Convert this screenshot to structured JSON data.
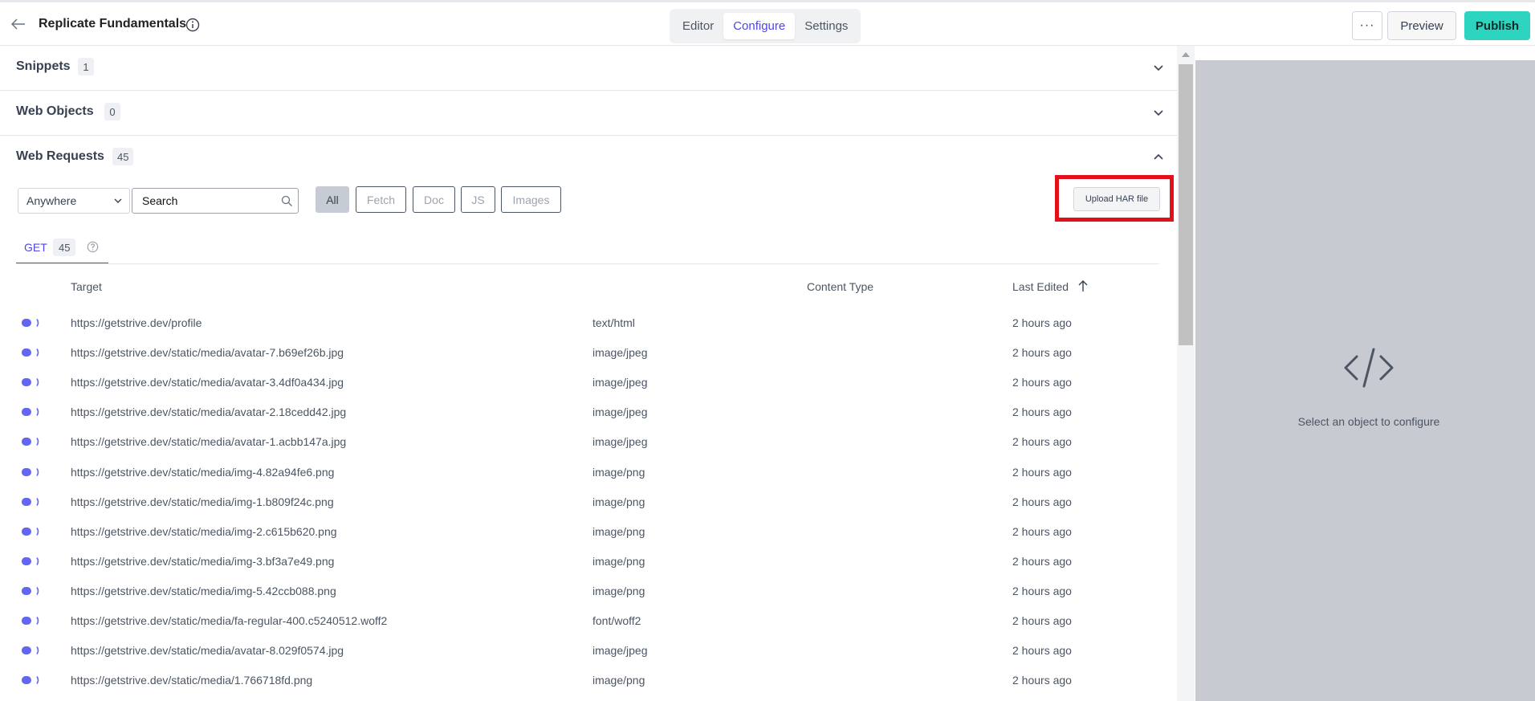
{
  "header": {
    "title": "Replicate Fundamentals",
    "tabs": [
      {
        "label": "Editor",
        "active": false
      },
      {
        "label": "Configure",
        "active": true
      },
      {
        "label": "Settings",
        "active": false
      }
    ],
    "more_label": "···",
    "preview_label": "Preview",
    "publish_label": "Publish"
  },
  "sections": {
    "snippets": {
      "title": "Snippets",
      "count": "1"
    },
    "web_objects": {
      "title": "Web Objects",
      "count": "0"
    },
    "web_requests": {
      "title": "Web Requests",
      "count": "45"
    }
  },
  "filters": {
    "location_select": "Anywhere",
    "search_placeholder": "Search",
    "chips": [
      "All",
      "Fetch",
      "Doc",
      "JS",
      "Images"
    ],
    "upload_label": "Upload HAR file"
  },
  "method_tab": {
    "label": "GET",
    "count": "45"
  },
  "columns": {
    "target": "Target",
    "content_type": "Content Type",
    "last_edited": "Last Edited"
  },
  "requests": [
    {
      "target": "https://getstrive.dev/profile",
      "type": "text/html",
      "edited": "2 hours ago"
    },
    {
      "target": "https://getstrive.dev/static/media/avatar-7.b69ef26b.jpg",
      "type": "image/jpeg",
      "edited": "2 hours ago"
    },
    {
      "target": "https://getstrive.dev/static/media/avatar-3.4df0a434.jpg",
      "type": "image/jpeg",
      "edited": "2 hours ago"
    },
    {
      "target": "https://getstrive.dev/static/media/avatar-2.18cedd42.jpg",
      "type": "image/jpeg",
      "edited": "2 hours ago"
    },
    {
      "target": "https://getstrive.dev/static/media/avatar-1.acbb147a.jpg",
      "type": "image/jpeg",
      "edited": "2 hours ago"
    },
    {
      "target": "https://getstrive.dev/static/media/img-4.82a94fe6.png",
      "type": "image/png",
      "edited": "2 hours ago"
    },
    {
      "target": "https://getstrive.dev/static/media/img-1.b809f24c.png",
      "type": "image/png",
      "edited": "2 hours ago"
    },
    {
      "target": "https://getstrive.dev/static/media/img-2.c615b620.png",
      "type": "image/png",
      "edited": "2 hours ago"
    },
    {
      "target": "https://getstrive.dev/static/media/img-3.bf3a7e49.png",
      "type": "image/png",
      "edited": "2 hours ago"
    },
    {
      "target": "https://getstrive.dev/static/media/img-5.42ccb088.png",
      "type": "image/png",
      "edited": "2 hours ago"
    },
    {
      "target": "https://getstrive.dev/static/media/fa-regular-400.c5240512.woff2",
      "type": "font/woff2",
      "edited": "2 hours ago"
    },
    {
      "target": "https://getstrive.dev/static/media/avatar-8.029f0574.jpg",
      "type": "image/jpeg",
      "edited": "2 hours ago"
    },
    {
      "target": "https://getstrive.dev/static/media/1.766718fd.png",
      "type": "image/png",
      "edited": "2 hours ago"
    }
  ],
  "right_panel": {
    "message": "Select an object to configure"
  },
  "colors": {
    "accent": "#4f46e5",
    "publish": "#2dd4bf",
    "highlight": "#e0111b",
    "panel": "#c8cad1"
  }
}
